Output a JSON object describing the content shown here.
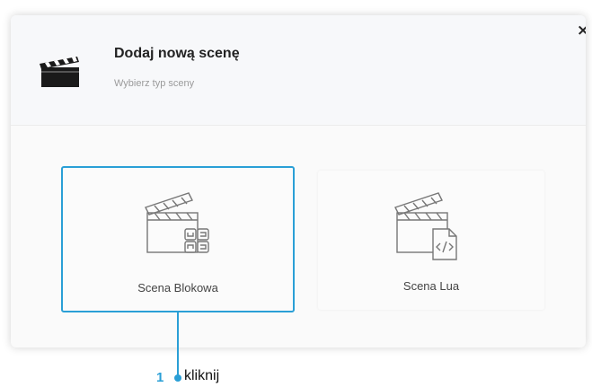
{
  "dialog": {
    "title": "Dodaj nową scenę",
    "subtitle": "Wybierz typ sceny",
    "close_label": "×",
    "header_icon": "clapperboard-icon"
  },
  "options": [
    {
      "label": "Scena Blokowa",
      "icon": "clapperboard-blocks-icon",
      "selected": true
    },
    {
      "label": "Scena Lua",
      "icon": "clapperboard-code-icon",
      "selected": false
    }
  ],
  "annotation": {
    "number": "1",
    "text": "kliknij",
    "color": "#2a9fd6"
  }
}
